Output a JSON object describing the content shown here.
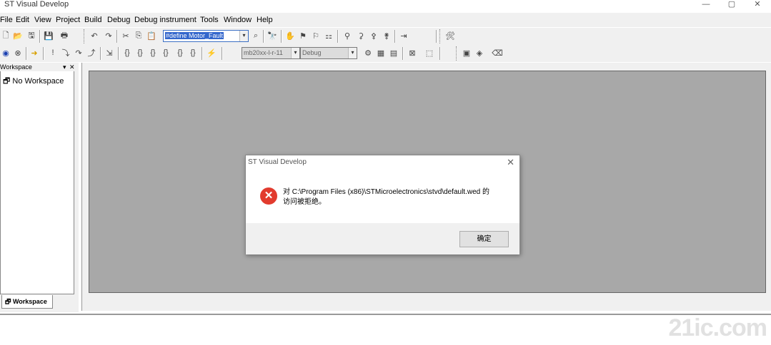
{
  "window": {
    "title": "ST Visual Develop",
    "minimize": "—",
    "maximize": "▢",
    "close": "✕"
  },
  "menu": [
    "File",
    "Edit",
    "View",
    "Project",
    "Build",
    "Debug",
    "Debug instrument",
    "Tools",
    "Window",
    "Help"
  ],
  "toolbar": {
    "find_combo_value": "#define    Motor_Fault",
    "target_combo_value": "mb20xx-l-r-11",
    "config_combo_value": "Debug"
  },
  "workspace": {
    "header": "Workspace",
    "item": "No Workspace",
    "tab": "Workspace"
  },
  "dialog": {
    "title": "ST Visual Develop",
    "message_line1": "对 C:\\Program Files (x86)\\STMicroelectronics\\stvd\\default.wed 的",
    "message_line2": "访问被拒绝。",
    "ok_label": "确定"
  },
  "watermark": "21ic.com"
}
